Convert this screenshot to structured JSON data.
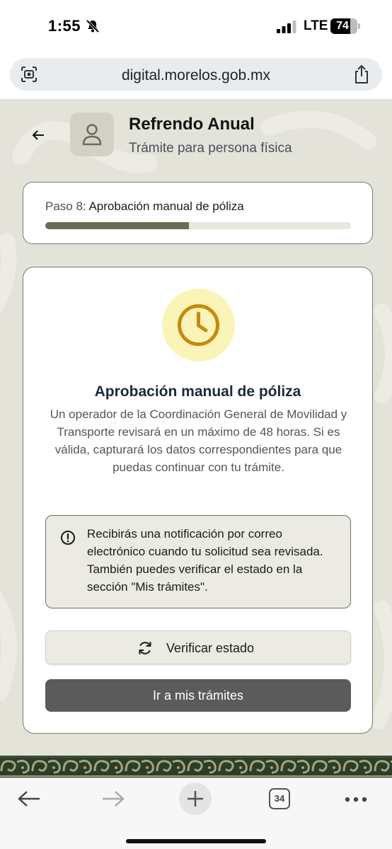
{
  "status_bar": {
    "time": "1:55",
    "network": "LTE",
    "battery": "74",
    "battery_level": 0.74
  },
  "browser": {
    "url": "digital.morelos.gob.mx",
    "tabs_count": "34"
  },
  "header": {
    "title": "Refrendo Anual",
    "subtitle": "Trámite para persona física"
  },
  "step": {
    "prefix": "Paso 8:",
    "name": "Aprobación manual de póliza",
    "progress_fraction": 0.47
  },
  "card": {
    "heading": "Aprobación manual de póliza",
    "description": "Un operador de la Coordinación General de Movilidad y Transporte revisará en un máximo de 48 horas. Si es válida, capturará los datos correspondientes para que puedas continuar con tu trámite.",
    "notice": "Recibirás una notificación por correo electrónico cuando tu solicitud sea revisada. También puedes verificar el estado en la sección \"Mis trámites\".",
    "verify_button": "Verificar estado",
    "tramites_button": "Ir a mis trámites"
  },
  "colors": {
    "accent": "#6b6d54",
    "page_bg": "#e4e3da",
    "clock": "#c9890b",
    "clock_bg": "#fbf4b8",
    "button_dark": "#5b5b5b"
  },
  "icons": [
    "bell-slash-icon",
    "signal-icon",
    "battery-icon",
    "lens-icon",
    "share-icon",
    "back-arrow-icon",
    "user-icon",
    "clock-icon",
    "info-icon",
    "refresh-icon",
    "forward-icon",
    "plus-icon",
    "tabs-icon",
    "more-icon"
  ]
}
